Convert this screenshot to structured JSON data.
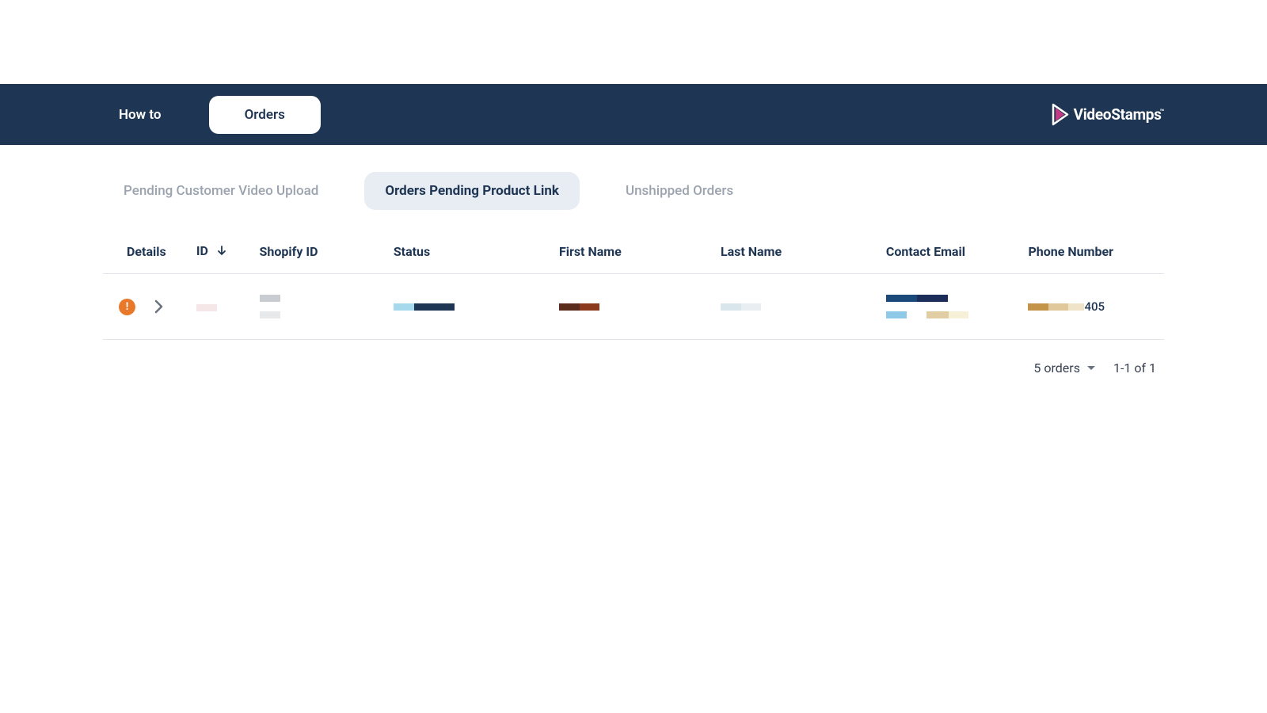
{
  "header": {
    "nav": {
      "howto": "How to",
      "orders": "Orders"
    },
    "brand": "VideoStamps"
  },
  "subtabs": {
    "pending_upload": "Pending Customer Video Upload",
    "pending_link": "Orders Pending Product Link",
    "unshipped": "Unshipped Orders"
  },
  "table": {
    "headers": {
      "details": "Details",
      "id": "ID",
      "shopify": "Shopify ID",
      "status": "Status",
      "first": "First Name",
      "last": "Last Name",
      "email": "Contact Email",
      "phone": "Phone Number"
    },
    "rows": [
      {
        "alert": "!",
        "phone_suffix": "405"
      }
    ]
  },
  "footer": {
    "page_size": "5 orders",
    "range": "1-1 of 1"
  }
}
